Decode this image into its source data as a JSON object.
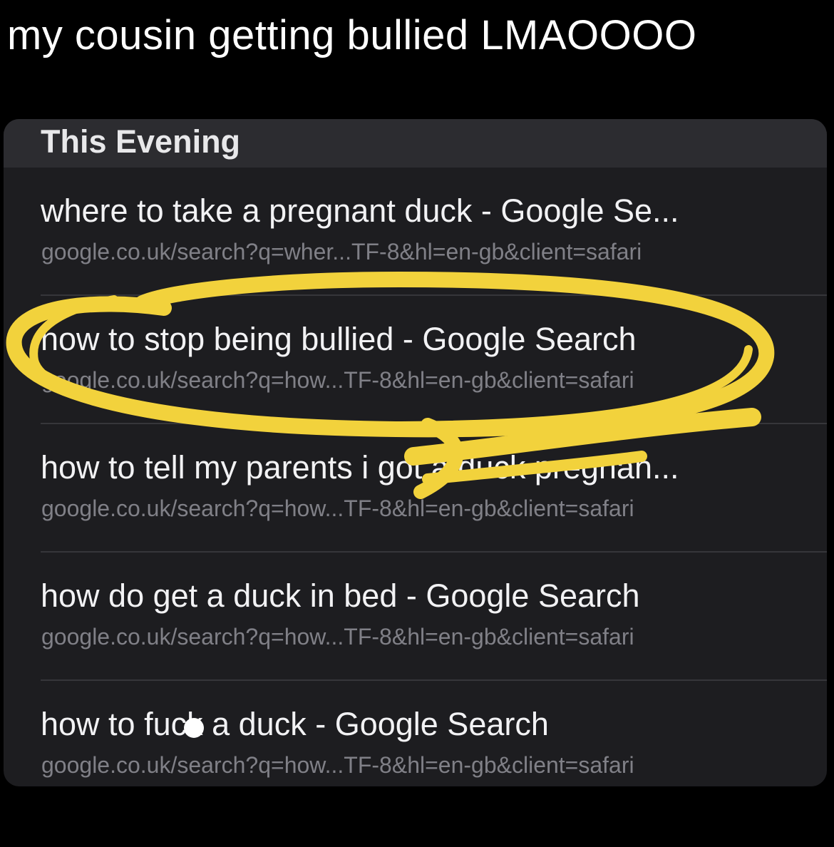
{
  "caption": "my cousin getting bullied LMAOOOO",
  "history": {
    "section_title": "This Evening",
    "items": [
      {
        "title": "where to take a pregnant duck - Google Se...",
        "url": "google.co.uk/search?q=wher...TF-8&hl=en-gb&client=safari"
      },
      {
        "title": "how to stop being bullied - Google Search",
        "url": "google.co.uk/search?q=how...TF-8&hl=en-gb&client=safari"
      },
      {
        "title": "how to tell my parents i got a duck pregnan...",
        "url": "google.co.uk/search?q=how...TF-8&hl=en-gb&client=safari"
      },
      {
        "title": "how do get a duck in bed - Google Search",
        "url": "google.co.uk/search?q=how...TF-8&hl=en-gb&client=safari"
      },
      {
        "title": "how to fuck a duck - Google Search",
        "url": "google.co.uk/search?q=how...TF-8&hl=en-gb&client=safari"
      }
    ]
  },
  "colors": {
    "highlight_scribble": "#f2d23c",
    "panel_background": "#1d1d20",
    "section_header_background": "#2c2c30"
  },
  "icons": {
    "annotation": "yellow-circle-scribble",
    "censor": "white-dot"
  }
}
